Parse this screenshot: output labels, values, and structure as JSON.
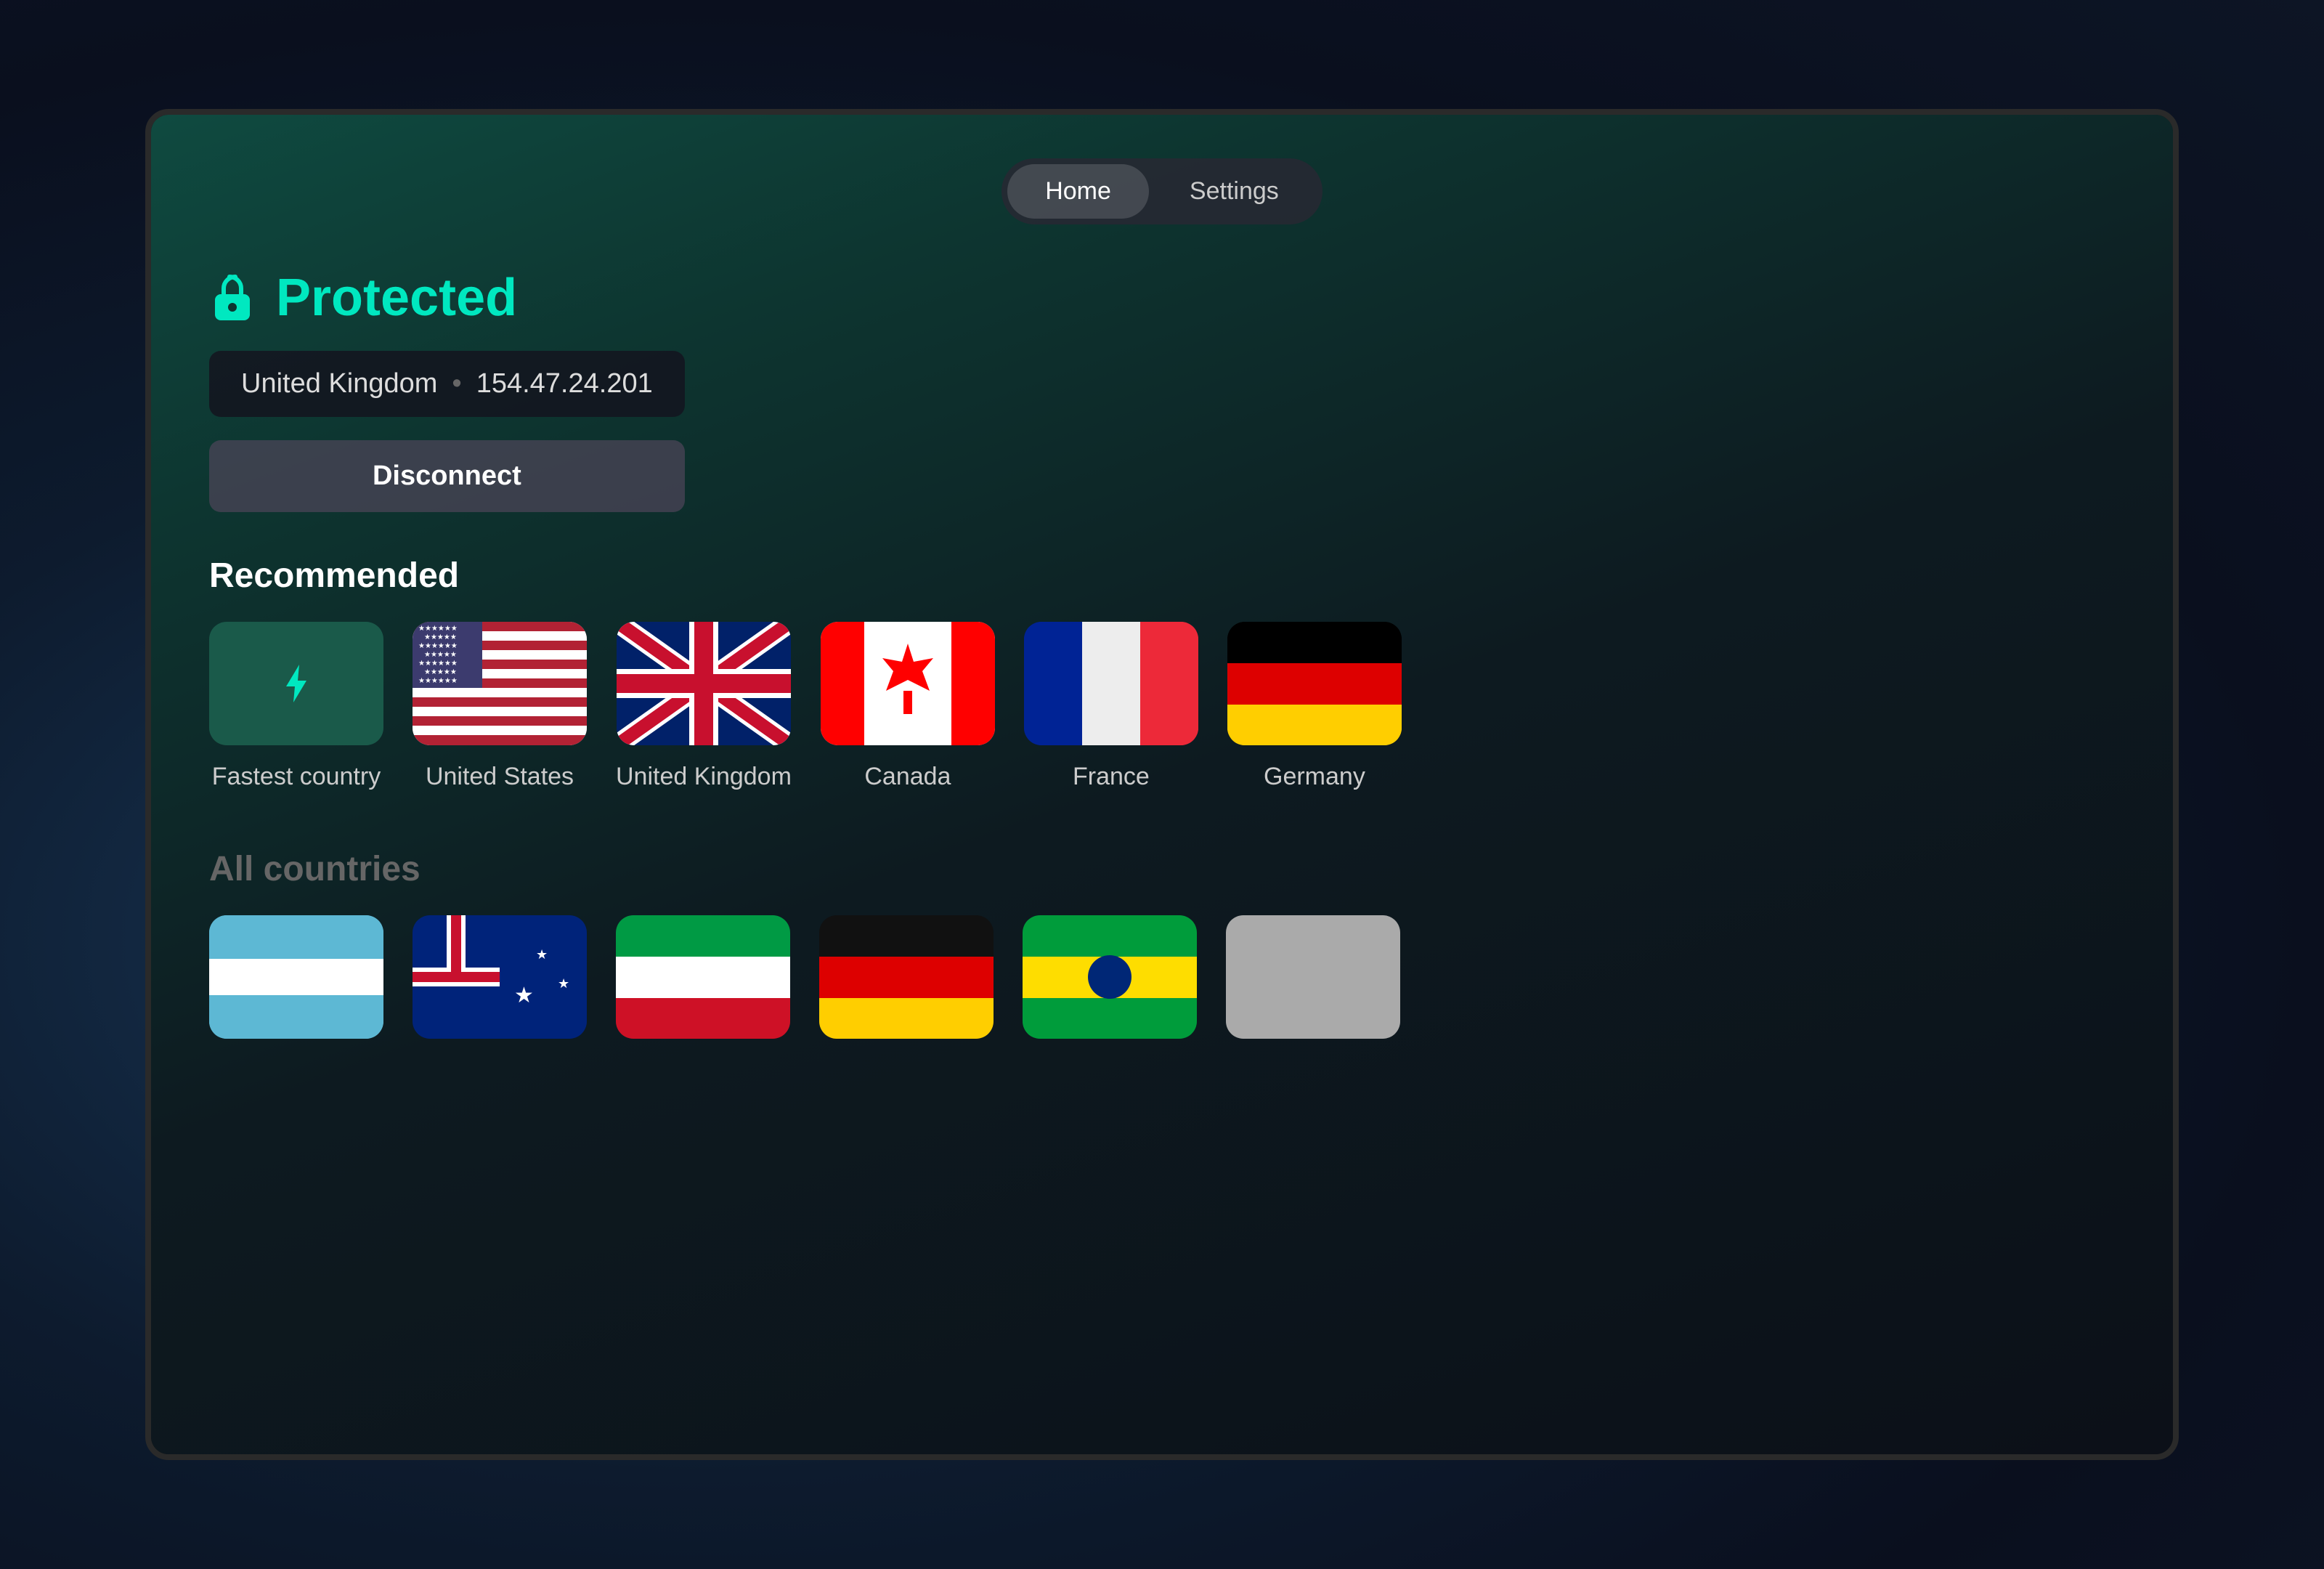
{
  "nav": {
    "home_label": "Home",
    "settings_label": "Settings"
  },
  "status": {
    "icon_label": "lock",
    "title": "Protected",
    "country": "United Kingdom",
    "ip": "154.47.24.201",
    "disconnect_label": "Disconnect"
  },
  "recommended": {
    "section_title": "Recommended",
    "countries": [
      {
        "id": "fastest",
        "label": "Fastest country",
        "type": "fastest"
      },
      {
        "id": "us",
        "label": "United States",
        "type": "us"
      },
      {
        "id": "uk",
        "label": "United Kingdom",
        "type": "uk"
      },
      {
        "id": "ca",
        "label": "Canada",
        "type": "ca"
      },
      {
        "id": "fr",
        "label": "France",
        "type": "fr"
      },
      {
        "id": "de",
        "label": "Germany",
        "type": "de"
      }
    ]
  },
  "all_countries": {
    "section_title": "All countries"
  },
  "colors": {
    "accent": "#00e8c0",
    "background_dark": "#0c1018",
    "nav_bg": "rgba(40,40,50,0.85)"
  }
}
